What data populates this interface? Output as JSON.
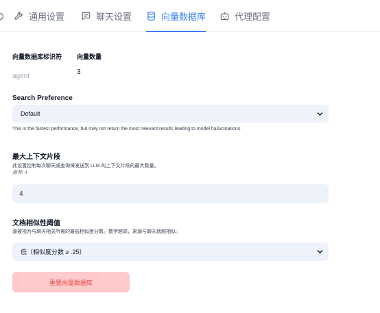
{
  "tabs": [
    {
      "label": "通用设置",
      "icon": "wrench-icon",
      "active": false
    },
    {
      "label": "聊天设置",
      "icon": "chat-bubble-icon",
      "active": false
    },
    {
      "label": "向量数据库",
      "icon": "database-icon",
      "active": true
    },
    {
      "label": "代理配置",
      "icon": "robot-icon",
      "active": false
    }
  ],
  "identifier": {
    "label": "向量数据库标识符",
    "value": "agent",
    "count_label": "向量数量",
    "count_value": "3"
  },
  "search_preference": {
    "title": "Search Preference",
    "selected": "Default",
    "help": "This is the fastest performance, but may not return the most relevant results leading to model hallucinations."
  },
  "max_context": {
    "title": "最大上下文片段",
    "help": "此设置控制每次聊天或查询将发送到 LLM 的上下文片段的最大数量。",
    "recommend": "推荐: 4",
    "value": "4"
  },
  "similarity": {
    "title": "文档相似性阈值",
    "help": "源被视为与聊天相关所需的最低相似度分数。数字越高，来源与聊天就越相似。",
    "selected": "低（相似度分数 ≥ .25）"
  },
  "reset_button": "重置向量数据库",
  "colors": {
    "accent": "#3b82f6",
    "field_bg": "#eef2fb",
    "danger_bg": "#fecaca",
    "danger_text": "#ef4444"
  }
}
